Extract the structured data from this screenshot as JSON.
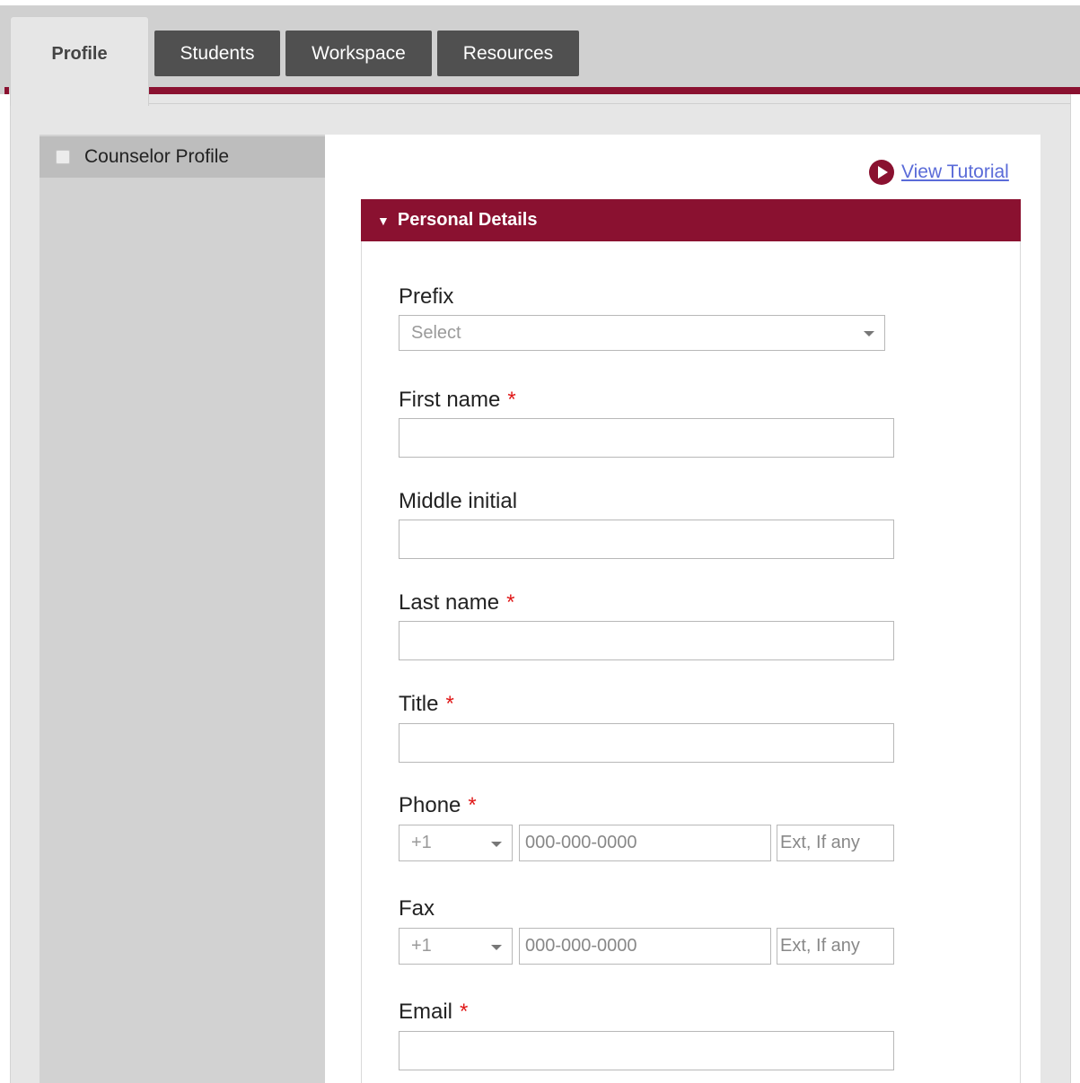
{
  "tabs": {
    "profile": "Profile",
    "students": "Students",
    "workspace": "Workspace",
    "resources": "Resources"
  },
  "sidebar": {
    "items": [
      {
        "label": "Counselor Profile",
        "checked": false
      }
    ]
  },
  "tutorial": {
    "label": "View Tutorial",
    "icon": "play-circle-icon"
  },
  "section": {
    "title": "Personal Details",
    "caret": "▼"
  },
  "form": {
    "prefix": {
      "label": "Prefix",
      "placeholder": "Select"
    },
    "first_name": {
      "label": "First name",
      "required": "*"
    },
    "middle_initial": {
      "label": "Middle initial"
    },
    "last_name": {
      "label": "Last name",
      "required": "*"
    },
    "title": {
      "label": "Title",
      "required": "*"
    },
    "phone": {
      "label": "Phone",
      "required": "*",
      "country_code": "+1",
      "number_placeholder": "000-000-0000",
      "ext_placeholder": "Ext, If any"
    },
    "fax": {
      "label": "Fax",
      "country_code": "+1",
      "number_placeholder": "000-000-0000",
      "ext_placeholder": "Ext, If any"
    },
    "email": {
      "label": "Email",
      "required": "*"
    }
  },
  "colors": {
    "accent": "#8a1130",
    "required": "#e01818",
    "link": "#5a6bd8",
    "tab_dark": "#505050"
  }
}
